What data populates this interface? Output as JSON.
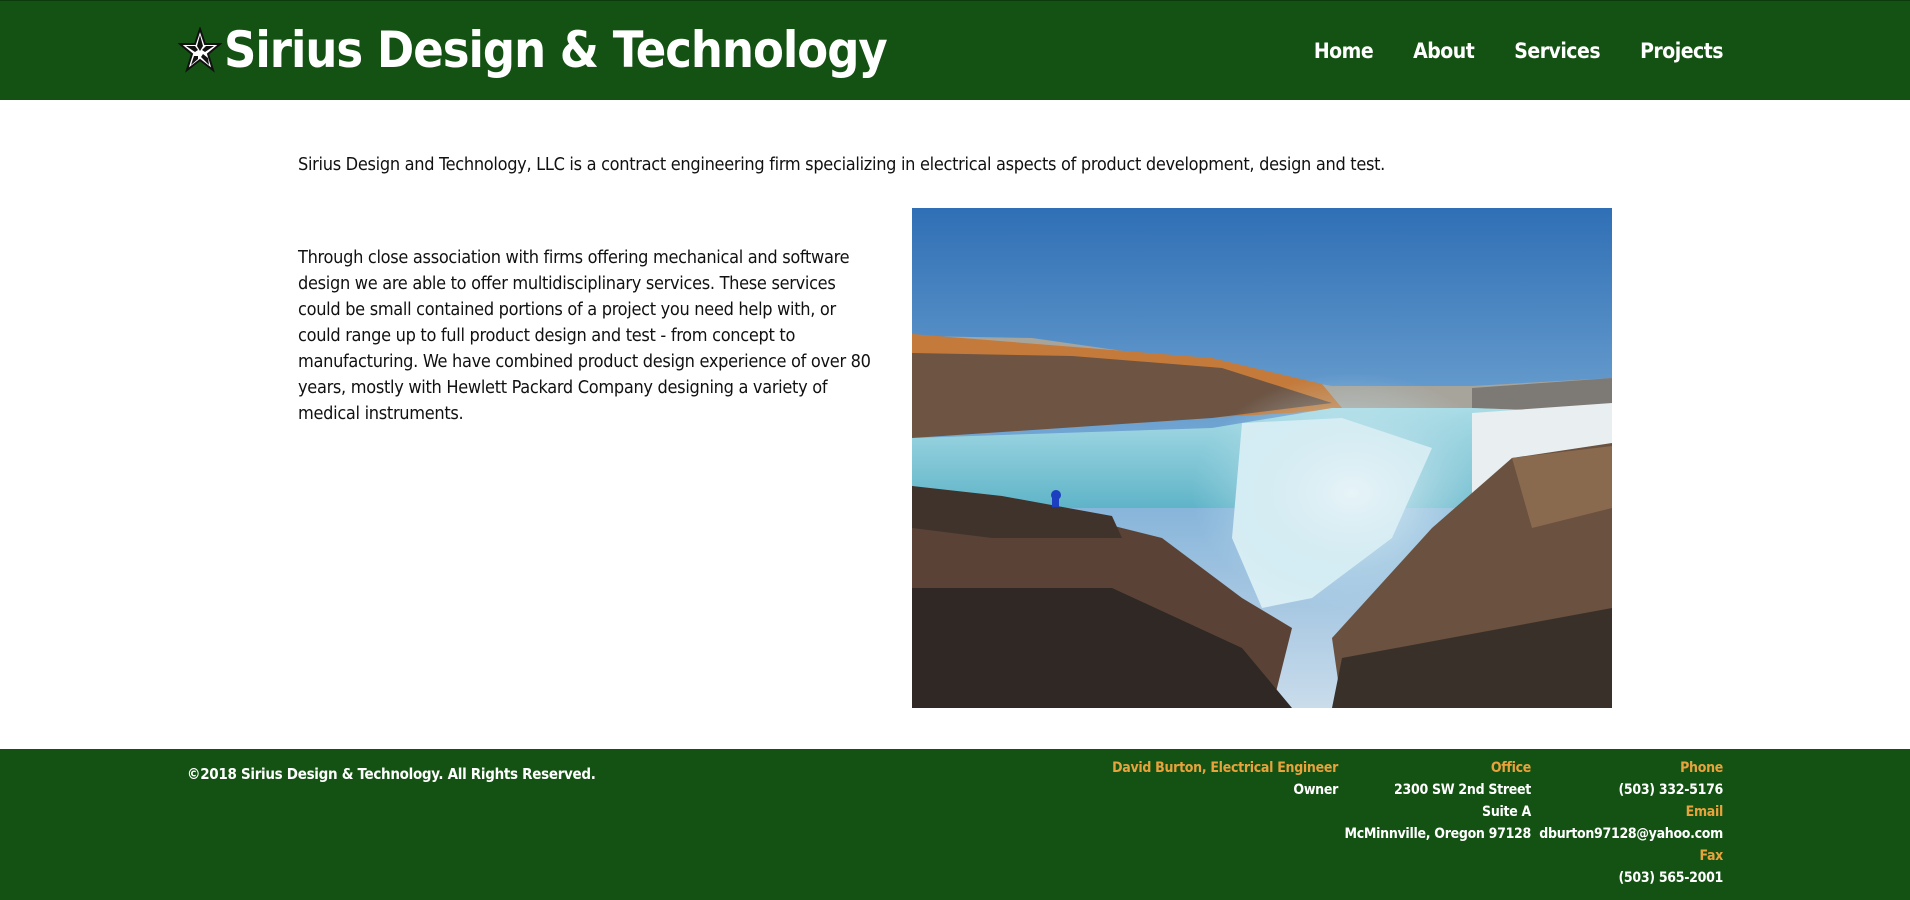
{
  "header": {
    "logo_icon": "star-icon",
    "title": "Sirius Design & Technology",
    "nav": [
      {
        "label": "Home"
      },
      {
        "label": "About"
      },
      {
        "label": "Services"
      },
      {
        "label": "Projects"
      }
    ]
  },
  "main": {
    "intro": "Sirius Design and Technology, LLC is a contract engineering firm specializing in electrical aspects of product development, design and test.",
    "body": "Through close association with firms offering mechanical and software design we are able to offer multidisciplinary services. These services could be small contained portions of a project you need help with, or could range up to full product design and test - from concept to manufacturing. We have combined product design experience of over 80 years, mostly with Hewlett Packard Company designing a variety of medical instruments.",
    "hero_image": "waterfall-canyon-photo"
  },
  "footer": {
    "copyright": "©2018 Sirius Design & Technology. All Rights Reserved.",
    "owner": {
      "heading": "David Burton, Electrical Engineer",
      "role": "Owner"
    },
    "office": {
      "heading": "Office",
      "line1": "2300 SW 2nd Street",
      "line2": "Suite A",
      "line3": "McMinnville, Oregon 97128"
    },
    "contact": {
      "phone_heading": "Phone",
      "phone": "(503) 332-5176",
      "email_heading": "Email",
      "email": "dburton97128@yahoo.com",
      "fax_heading": "Fax",
      "fax": "(503) 565-2001"
    }
  },
  "colors": {
    "header_green": "#135212",
    "accent_orange": "#e8a33d",
    "text_dark": "#111111"
  }
}
